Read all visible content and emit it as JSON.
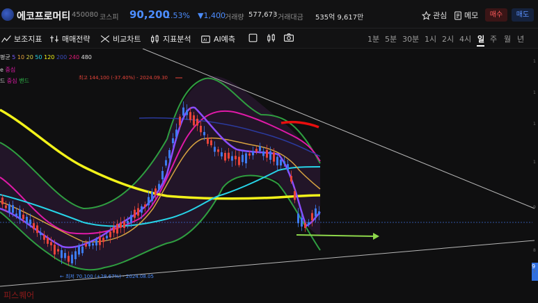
{
  "header": {
    "stock_name": "에코프로머티",
    "code": "450080",
    "market": "코스피",
    "price": "90,200",
    "change_pct": "-1.53%",
    "change_amt": "▼1,400",
    "volume_label": "거래량",
    "volume_value": "577,673",
    "amount_label": "거래대금",
    "amount_value": "535억 9,617만",
    "watch_label": "관심",
    "memo_label": "메모",
    "buy_label": "매수",
    "sell_label": "매도"
  },
  "toolbar": {
    "tools": [
      "보조지표",
      "매매전략",
      "비교차트",
      "지표분석",
      "AI예측"
    ],
    "periods": [
      "1분",
      "5분",
      "30분",
      "1시",
      "2시",
      "4시",
      "일",
      "주",
      "월",
      "년"
    ],
    "active_period": "일"
  },
  "legend": {
    "ma_label": "평균",
    "ma_periods": [
      "5",
      "10",
      "20",
      "50",
      "120",
      "200",
      "240",
      "480"
    ],
    "ma_colors": [
      "#7a5cff",
      "#e8a23a",
      "#d6d146",
      "#27d4e8",
      "#f2f21a",
      "#2b3a9e",
      "#e01a78",
      "#e0e0e0"
    ],
    "line2_prefix": "e",
    "line2_label": "중심",
    "line3_prefix": "드",
    "line3_mid": "중심",
    "line3_band": "밴드"
  },
  "annotations": {
    "high": "최고 144,100 (-37.40%) - 2024.09.30",
    "low": "최저 70,100 (+28.67%) - 2024.08.05"
  },
  "price_tag": "9",
  "right_axis": [
    "1",
    "1",
    "1",
    "1",
    "9",
    "8",
    "7"
  ],
  "watermark": "피스퀘어",
  "colors": {
    "up": "#e8443a",
    "down": "#3d7bf0",
    "accent_blue": "#4c8dff"
  }
}
